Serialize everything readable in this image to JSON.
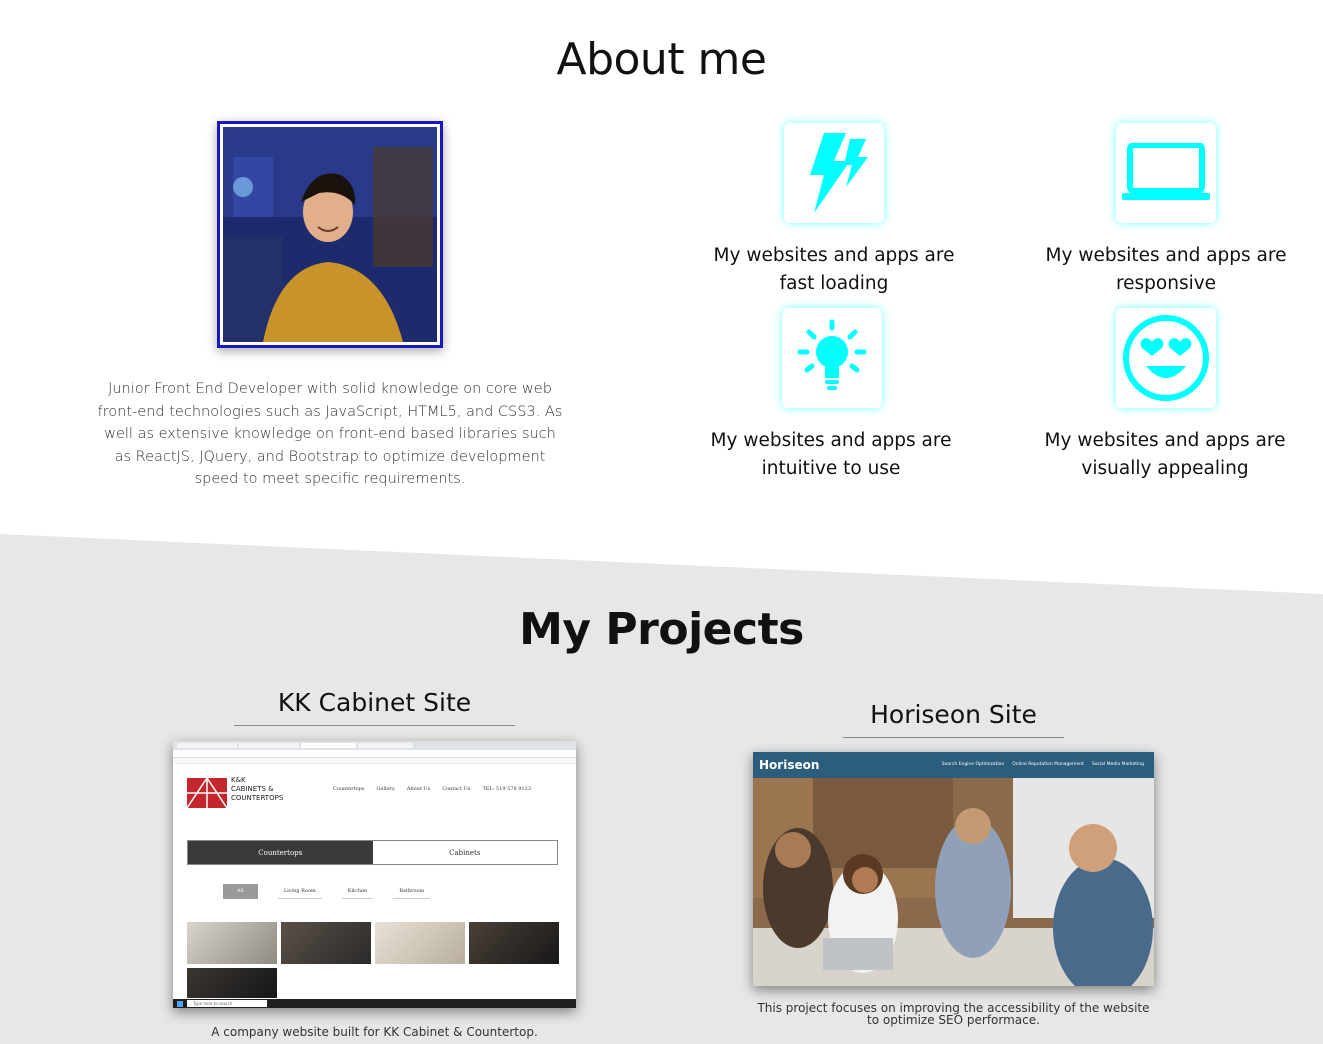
{
  "about": {
    "title": "About me",
    "bio": "Junior Front End Developer with solid knowledge on core web front-end technologies such as JavaScript, HTML5, and CSS3. As well as extensive knowledge on front-end based libraries such as ReactJS, JQuery, and Bootstrap to optimize development speed to meet specific requirements.",
    "features": [
      {
        "icon": "lightning-icon",
        "line1": "My websites and apps are",
        "line2": "fast loading"
      },
      {
        "icon": "laptop-icon",
        "line1": "My websites and apps are",
        "line2": "responsive"
      },
      {
        "icon": "lightbulb-icon",
        "line1": "My websites and apps are",
        "line2": "intuitive to use"
      },
      {
        "icon": "heart-eyes-icon",
        "line1": "My websites and apps are",
        "line2": "visually appealing"
      }
    ]
  },
  "projects": {
    "title": "My Projects",
    "items": [
      {
        "title": "KK Cabinet Site",
        "caption": "A company website built for KK Cabinet & Countertop.",
        "screenshot": {
          "logo_line1": "K&K",
          "logo_line2": "CABINETS &",
          "logo_line3": "COUNTERTOPS",
          "nav": [
            "Countertops",
            "Gallery",
            "About Us",
            "Contact Us",
            "TEL: 519 578 9123"
          ],
          "tabs": [
            "Countertops",
            "Cabinets"
          ],
          "filters": [
            "All",
            "Living Room",
            "Kitchen",
            "Bathroom"
          ],
          "search_placeholder": "Type here to search"
        }
      },
      {
        "title": "Horiseon Site",
        "caption": "This project focuses on improving the accessibility of the website to optimize SEO performace.",
        "screenshot": {
          "brand": "Horiseon",
          "nav": [
            "Search Engine Optimization",
            "Online Reputation Management",
            "Social Media Marketing"
          ]
        }
      }
    ]
  },
  "colors": {
    "accent": "#00ffff",
    "photo_border": "#1b17b8",
    "section_bg": "#e7e7e7",
    "horiseon_header": "#2b5d7c"
  }
}
